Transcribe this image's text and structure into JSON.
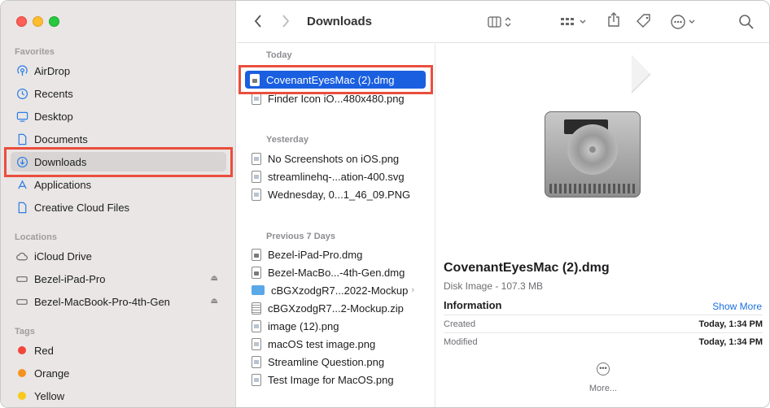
{
  "toolbar": {
    "title": "Downloads",
    "back_icon": "chevron-left-icon",
    "forward_icon": "chevron-right-icon",
    "view_icon": "columns-view-icon",
    "group_icon": "grid-icon",
    "share_icon": "share-icon",
    "tag_icon": "tag-icon",
    "action_icon": "ellipsis-circle-icon",
    "search_icon": "search-icon"
  },
  "sidebar": {
    "favorites_label": "Favorites",
    "favorites": [
      {
        "label": "AirDrop",
        "icon": "airdrop-icon"
      },
      {
        "label": "Recents",
        "icon": "clock-icon"
      },
      {
        "label": "Desktop",
        "icon": "desktop-icon"
      },
      {
        "label": "Documents",
        "icon": "document-icon"
      },
      {
        "label": "Downloads",
        "icon": "download-icon",
        "selected": true
      },
      {
        "label": "Applications",
        "icon": "applications-icon"
      },
      {
        "label": "Creative Cloud Files",
        "icon": "file-icon"
      }
    ],
    "locations_label": "Locations",
    "locations": [
      {
        "label": "iCloud Drive",
        "icon": "cloud-icon"
      },
      {
        "label": "Bezel-iPad-Pro",
        "icon": "drive-icon"
      },
      {
        "label": "Bezel-MacBook-Pro-4th-Gen",
        "icon": "drive-icon"
      }
    ],
    "tags_label": "Tags",
    "tags": [
      {
        "label": "Red",
        "color": "#f2463a"
      },
      {
        "label": "Orange",
        "color": "#f6921e"
      },
      {
        "label": "Yellow",
        "color": "#f8c91c"
      }
    ]
  },
  "files": {
    "today_label": "Today",
    "today": [
      {
        "name": "CovenantEyesMac (2).dmg",
        "kind": "dmg",
        "selected": true
      },
      {
        "name": "Finder Icon iO...480x480.png",
        "kind": "img"
      }
    ],
    "yesterday_label": "Yesterday",
    "yesterday": [
      {
        "name": "No Screenshots on iOS.png",
        "kind": "img"
      },
      {
        "name": "streamlinehq-...ation-400.svg",
        "kind": "img"
      },
      {
        "name": "Wednesday, 0...1_46_09.PNG",
        "kind": "img"
      }
    ],
    "previous_label": "Previous 7 Days",
    "previous": [
      {
        "name": "Bezel-iPad-Pro.dmg",
        "kind": "dmg"
      },
      {
        "name": "Bezel-MacBo...-4th-Gen.dmg",
        "kind": "dmg"
      },
      {
        "name": "cBGXzodgR7...2022-Mockup",
        "kind": "folder"
      },
      {
        "name": "cBGXzodgR7...2-Mockup.zip",
        "kind": "zip"
      },
      {
        "name": "image (12).png",
        "kind": "img"
      },
      {
        "name": "macOS test image.png",
        "kind": "img"
      },
      {
        "name": "Streamline Question.png",
        "kind": "img"
      },
      {
        "name": "Test Image for MacOS.png",
        "kind": "img"
      }
    ]
  },
  "preview": {
    "name": "CovenantEyesMac (2).dmg",
    "kind": "Disk Image - 107.3 MB",
    "info_label": "Information",
    "show_more": "Show More",
    "created_label": "Created",
    "created_value": "Today, 1:34 PM",
    "modified_label": "Modified",
    "modified_value": "Today, 1:34 PM",
    "more_label": "More..."
  }
}
